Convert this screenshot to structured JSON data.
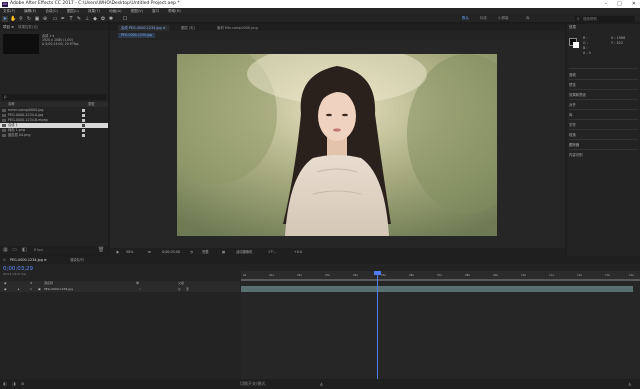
{
  "window": {
    "title": "Adobe After Effects CC 2017 - C:\\Users\\WHO\\Desktop\\Untitled Project.aep *",
    "logo": "Ae"
  },
  "menu": [
    "文件(F)",
    "编辑(E)",
    "合成(C)",
    "图层(L)",
    "效果(T)",
    "动画(A)",
    "视图(V)",
    "窗口",
    "帮助(H)"
  ],
  "toolbar": {
    "workspaces": [
      "默认",
      "标准",
      "小屏幕",
      "库"
    ],
    "search_placeholder": "搜索帮助"
  },
  "project": {
    "tabs": [
      "项目 ≡",
      "效果控件(无)"
    ],
    "selected_name": "合成 1 ▾",
    "selected_info": [
      "1920 x 1080 (1.00)",
      "Δ 0;00;15;00, 29.97fps"
    ],
    "search_value": "ρ",
    "columns": {
      "name": "名称",
      "type": "类型"
    },
    "items": [
      {
        "name": "mmm.comp/0000.jpg"
      },
      {
        "name": "PEG-0000-1234-A.jpg"
      },
      {
        "name": "PEG-0000-1234-B.mpeg"
      },
      {
        "name": "合成 1",
        "selected": true
      },
      {
        "name": "纯色 1.png"
      },
      {
        "name": "固态层 04.png"
      }
    ],
    "bpc": "8 bpc"
  },
  "viewer": {
    "tabs": [
      {
        "label": "合成 PEG-0000-1234.jpg ≡",
        "active": true
      },
      {
        "label": "图层 (无)",
        "active": false
      },
      {
        "label": "素材 Mm.comp0000.png",
        "active": false
      }
    ],
    "breadcrumb": "PEG-0000-1234.jpg",
    "bar": {
      "zoom": "50%",
      "timecode": "0;00;05;00",
      "quality": "完整",
      "camera": "活动摄像机",
      "views": "1个...",
      "offset": "+0.0"
    }
  },
  "right_panel": {
    "header": "信息",
    "items": [
      "音频",
      "预览",
      "效果和预设",
      "对齐",
      "库",
      "字符",
      "段落",
      "跟踪器",
      "内容识别"
    ],
    "rgb": [
      "R :",
      "G :",
      "B :",
      "A : 0"
    ],
    "xy": [
      "X : 1966",
      "Y : 320"
    ]
  },
  "timeline": {
    "tabs": [
      {
        "label": "PEG-0000-1234.jpg ≡",
        "active": true
      },
      {
        "label": "渲染队列",
        "active": false
      }
    ],
    "current_time": "0;00;03;29",
    "fps_info": "00119 (29.97 fps)",
    "columns": [
      "#",
      "源名称",
      "单",
      "父级"
    ],
    "layer": {
      "index": "1",
      "name": "PEG-0000-1234.jpg",
      "parent": "无"
    },
    "ruler": [
      "0s",
      "01s",
      "02s",
      "03s",
      "04s",
      "05s",
      "06s",
      "07s",
      "08s",
      "09s",
      "10s",
      "11s",
      "12s",
      "13s",
      "14s"
    ],
    "footer": "切换开关/模式"
  }
}
